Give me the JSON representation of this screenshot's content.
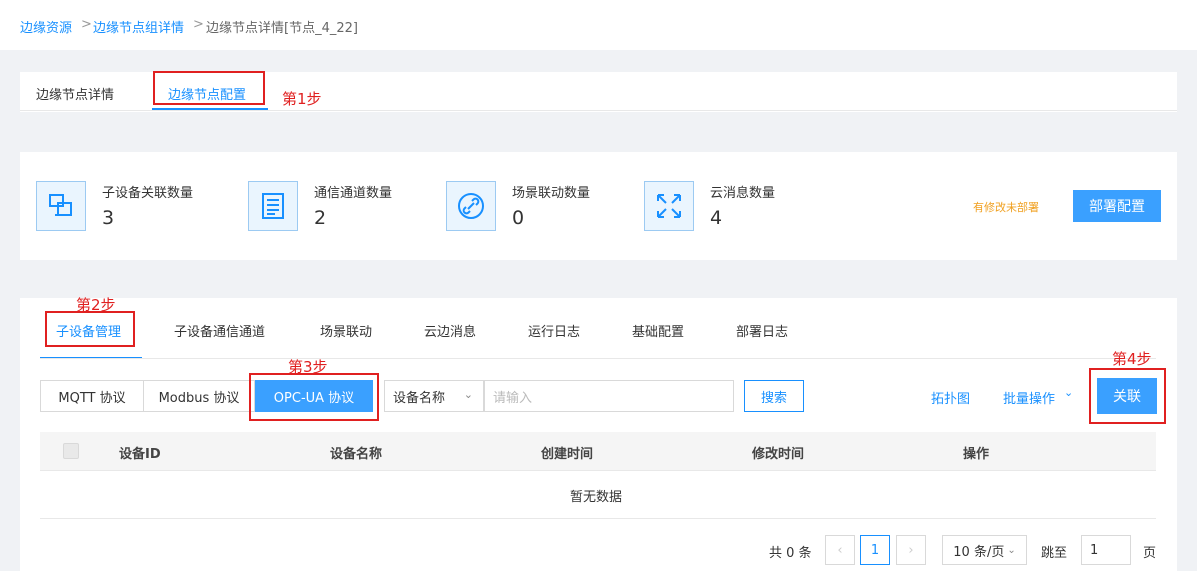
{
  "breadcrumb": {
    "items": [
      "边缘资源",
      "边缘节点组详情",
      "边缘节点详情[节点_4_22]"
    ],
    "separator": ">"
  },
  "top_tabs": [
    "边缘节点详情",
    "边缘节点配置"
  ],
  "annotations": {
    "step1": "第1步",
    "step2": "第2步",
    "step3": "第3步",
    "step4": "第4步"
  },
  "stats": [
    {
      "label": "子设备关联数量",
      "value": "3",
      "icon": "devices-icon"
    },
    {
      "label": "通信通道数量",
      "value": "2",
      "icon": "list-icon"
    },
    {
      "label": "场景联动数量",
      "value": "0",
      "icon": "link-icon"
    },
    {
      "label": "云消息数量",
      "value": "4",
      "icon": "arrows-icon"
    }
  ],
  "deploy": {
    "warning": "有修改未部署",
    "button": "部署配置"
  },
  "sub_tabs": [
    "子设备管理",
    "子设备通信通道",
    "场景联动",
    "云边消息",
    "运行日志",
    "基础配置",
    "部署日志"
  ],
  "protocols": [
    "MQTT 协议",
    "Modbus 协议",
    "OPC-UA 协议"
  ],
  "filter": {
    "select_value": "设备名称",
    "input_placeholder": "请输入",
    "search_button": "搜索"
  },
  "actions": {
    "topology": "拓扑图",
    "batch": "批量操作",
    "associate": "关联"
  },
  "table": {
    "columns": [
      "设备ID",
      "设备名称",
      "创建时间",
      "修改时间",
      "操作"
    ],
    "empty_text": "暂无数据"
  },
  "pagination": {
    "total": "共 0 条",
    "current_page": "1",
    "page_size": "10 条/页",
    "jump_label": "跳至",
    "jump_value": "1",
    "page_unit": "页"
  },
  "colors": {
    "primary": "#1890ff",
    "annotation": "#e02020",
    "warning": "#f0a020"
  }
}
